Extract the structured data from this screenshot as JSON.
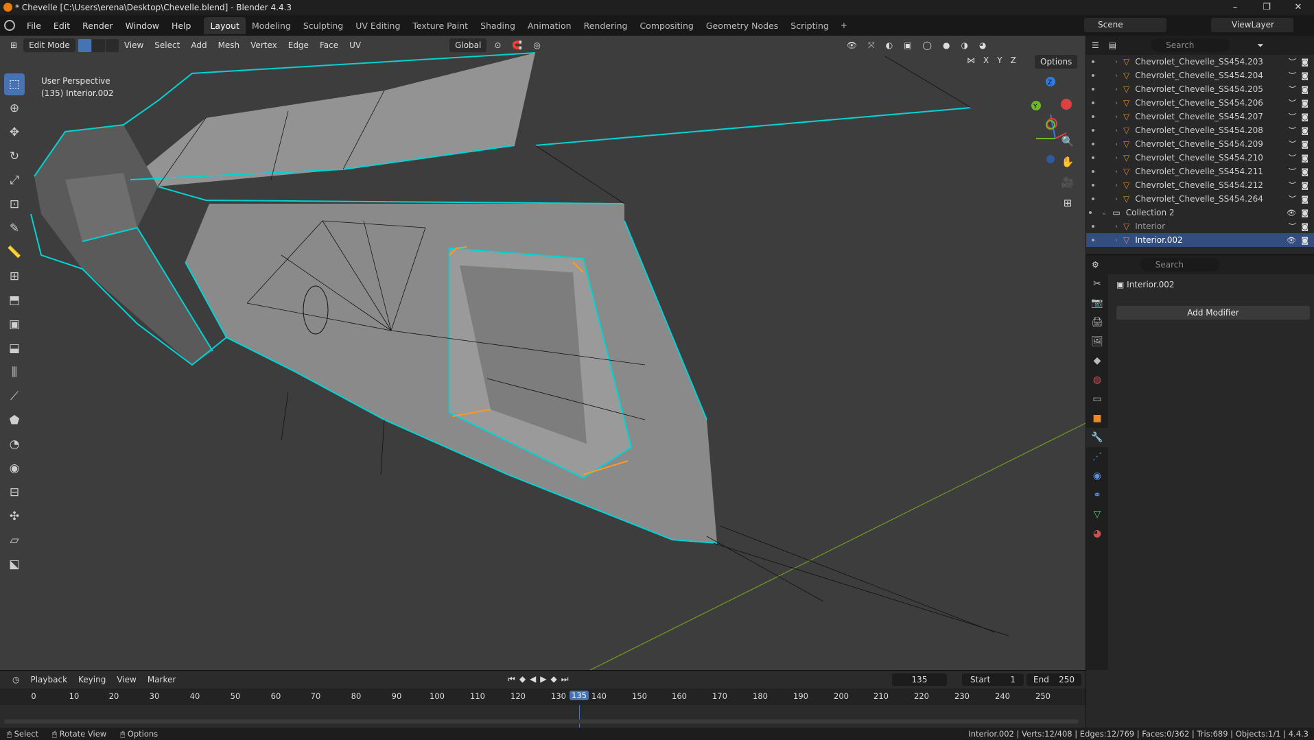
{
  "title": "* Chevelle [C:\\Users\\erena\\Desktop\\Chevelle.blend] - Blender 4.4.3",
  "window_controls": [
    "–",
    "❐",
    "✕"
  ],
  "menu": [
    "File",
    "Edit",
    "Render",
    "Window",
    "Help"
  ],
  "workspaces": [
    "Layout",
    "Modeling",
    "Sculpting",
    "UV Editing",
    "Texture Paint",
    "Shading",
    "Animation",
    "Rendering",
    "Compositing",
    "Geometry Nodes",
    "Scripting"
  ],
  "active_workspace": "Layout",
  "scene": "Scene",
  "view_layer": "ViewLayer",
  "viewport": {
    "mode": "Edit Mode",
    "menus": [
      "View",
      "Select",
      "Add",
      "Mesh",
      "Vertex",
      "Edge",
      "Face",
      "UV"
    ],
    "orientation": "Global",
    "options": "Options",
    "perspective": "User Perspective",
    "object_info": "(135) Interior.002",
    "axes": [
      "X",
      "Y",
      "Z"
    ]
  },
  "tools": [
    "select-box",
    "cursor",
    "move",
    "rotate",
    "scale",
    "transform",
    "annotate",
    "measure",
    "add-cube",
    "extrude",
    "inset",
    "bevel",
    "loop-cut",
    "knife",
    "poly-build",
    "spin",
    "smooth",
    "edge-slide",
    "shrink-fatten",
    "shear",
    "rip"
  ],
  "outliner": {
    "search_placeholder": "Search",
    "items": [
      {
        "name": "Chevrolet_Chevelle_SS454.203",
        "type": "mesh"
      },
      {
        "name": "Chevrolet_Chevelle_SS454.204",
        "type": "mesh"
      },
      {
        "name": "Chevrolet_Chevelle_SS454.205",
        "type": "mesh"
      },
      {
        "name": "Chevrolet_Chevelle_SS454.206",
        "type": "mesh"
      },
      {
        "name": "Chevrolet_Chevelle_SS454.207",
        "type": "mesh"
      },
      {
        "name": "Chevrolet_Chevelle_SS454.208",
        "type": "mesh"
      },
      {
        "name": "Chevrolet_Chevelle_SS454.209",
        "type": "mesh"
      },
      {
        "name": "Chevrolet_Chevelle_SS454.210",
        "type": "mesh"
      },
      {
        "name": "Chevrolet_Chevelle_SS454.211",
        "type": "mesh"
      },
      {
        "name": "Chevrolet_Chevelle_SS454.212",
        "type": "mesh"
      },
      {
        "name": "Chevrolet_Chevelle_SS454.264",
        "type": "mesh"
      },
      {
        "name": "Collection 2",
        "type": "collection"
      },
      {
        "name": "Interior",
        "type": "mesh"
      },
      {
        "name": "Interior.002",
        "type": "mesh",
        "selected": true
      }
    ]
  },
  "properties": {
    "search_placeholder": "Search",
    "object": "Interior.002",
    "add_modifier": "Add Modifier"
  },
  "timeline": {
    "menus": [
      "Playback",
      "Keying",
      "View",
      "Marker"
    ],
    "current_frame": "135",
    "start_label": "Start",
    "start": "1",
    "end_label": "End",
    "end": "250",
    "ticks": [
      "0",
      "10",
      "20",
      "30",
      "40",
      "50",
      "60",
      "70",
      "80",
      "90",
      "100",
      "110",
      "120",
      "130",
      "140",
      "150",
      "160",
      "170",
      "180",
      "190",
      "200",
      "210",
      "220",
      "230",
      "240",
      "250"
    ]
  },
  "statusbar": {
    "left": [
      "Select",
      "Rotate View",
      "Options"
    ],
    "stats": "Interior.002 | Verts:12/408 | Edges:12/769 | Faces:0/362 | Tris:689 | Objects:1/1 | 4.4.3"
  },
  "colors": {
    "accent": "#4772b3",
    "selected_edge": "#00d4d4",
    "active_edge": "#ff9a1f",
    "viewport_bg": "#3d3d3d",
    "y_axis": "#6f9d23"
  }
}
